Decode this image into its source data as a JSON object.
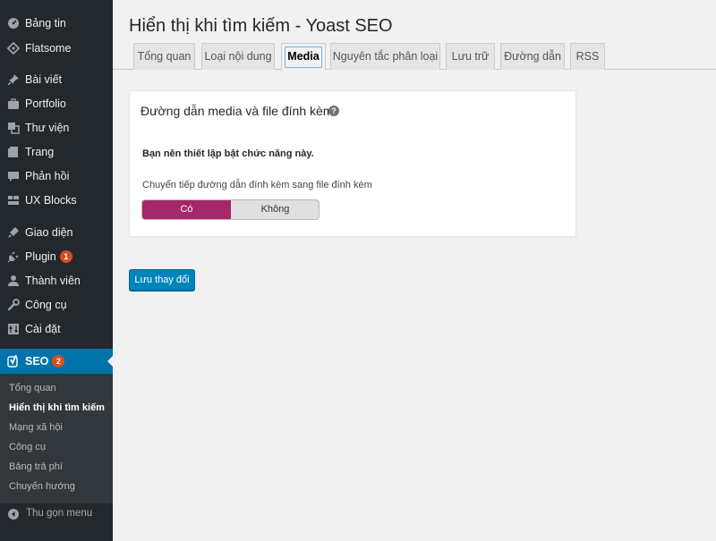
{
  "sidebar": {
    "items": [
      {
        "label": "Bảng tin",
        "icon": "dashboard-icon"
      },
      {
        "label": "Flatsome",
        "icon": "flatsome-icon"
      },
      {
        "label": "Bài viết",
        "icon": "pin-icon"
      },
      {
        "label": "Portfolio",
        "icon": "portfolio-icon"
      },
      {
        "label": "Thư viện",
        "icon": "media-icon"
      },
      {
        "label": "Trang",
        "icon": "page-icon"
      },
      {
        "label": "Phản hồi",
        "icon": "comment-icon"
      },
      {
        "label": "UX Blocks",
        "icon": "blocks-icon"
      },
      {
        "label": "Giao diện",
        "icon": "appearance-icon"
      },
      {
        "label": "Plugin",
        "icon": "plugin-icon",
        "badge": "1"
      },
      {
        "label": "Thành viên",
        "icon": "users-icon"
      },
      {
        "label": "Công cụ",
        "icon": "tools-icon"
      },
      {
        "label": "Cài đặt",
        "icon": "settings-icon"
      },
      {
        "label": "SEO",
        "icon": "yoast-icon",
        "badge": "2"
      }
    ],
    "submenu": [
      "Tổng quan",
      "Hiển thị khi tìm kiếm",
      "Mạng xã hội",
      "Công cụ",
      "Bảng trả phí",
      "Chuyển hướng"
    ],
    "collapse_label": "Thu gọn menu"
  },
  "page": {
    "title": "Hiển thị khi tìm kiếm - Yoast SEO"
  },
  "tabs": [
    "Tổng quan",
    "Loại nội dung",
    "Media",
    "Nguyên tắc phân loại",
    "Lưu trữ",
    "Đường dẫn",
    "RSS"
  ],
  "active_tab": "Media",
  "card": {
    "title": "Đường dẫn media và file đính kèm",
    "help_glyph": "?",
    "recommendation": "Bạn nên thiết lập bật chức năng này.",
    "toggle_label": "Chuyển tiếp đường dẫn đính kèm sang file đính kèm",
    "toggle_on": "Có",
    "toggle_off": "Không",
    "toggle_selected": "Có"
  },
  "save_button": "Lưu thay đổi",
  "colors": {
    "sidebar_bg": "#23282d",
    "active_menu": "#0073aa",
    "toggle_on": "#a4286a",
    "button": "#0085ba",
    "badge": "#d54e21"
  }
}
